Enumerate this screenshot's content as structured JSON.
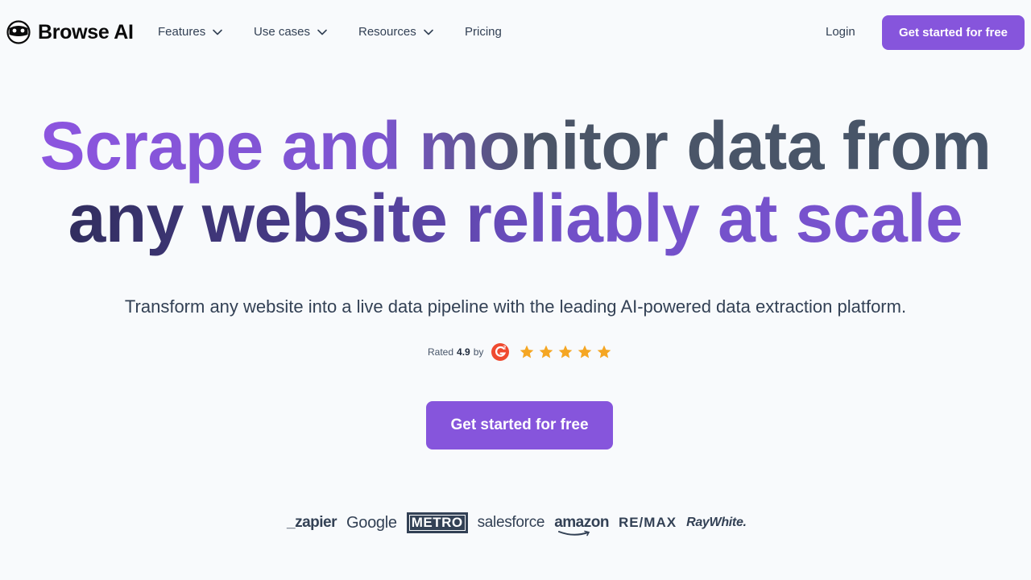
{
  "brand": {
    "name": "Browse AI"
  },
  "nav": {
    "items": [
      {
        "label": "Features",
        "has_dropdown": true
      },
      {
        "label": "Use cases",
        "has_dropdown": true
      },
      {
        "label": "Resources",
        "has_dropdown": true
      },
      {
        "label": "Pricing",
        "has_dropdown": false
      }
    ],
    "login_label": "Login",
    "cta_label": "Get started for free"
  },
  "hero": {
    "title_line1": "Scrape and monitor data from",
    "title_line2": "any website reliably at scale",
    "subtitle": "Transform any website into a live data pipeline with the leading AI-powered data extraction platform.",
    "rating": {
      "prefix": "Rated",
      "value": "4.9",
      "by": "by",
      "platform_icon": "g2-logo-icon",
      "stars": 5
    },
    "cta_label": "Get started for free"
  },
  "customers": {
    "logos": [
      "_zapier",
      "Google",
      "METRO",
      "salesforce",
      "amazon",
      "RE/MAX",
      "RayWhite."
    ]
  },
  "colors": {
    "accent": "#8655dc",
    "text": "#334155",
    "background": "#f8fafc",
    "star": "#f5a623"
  }
}
